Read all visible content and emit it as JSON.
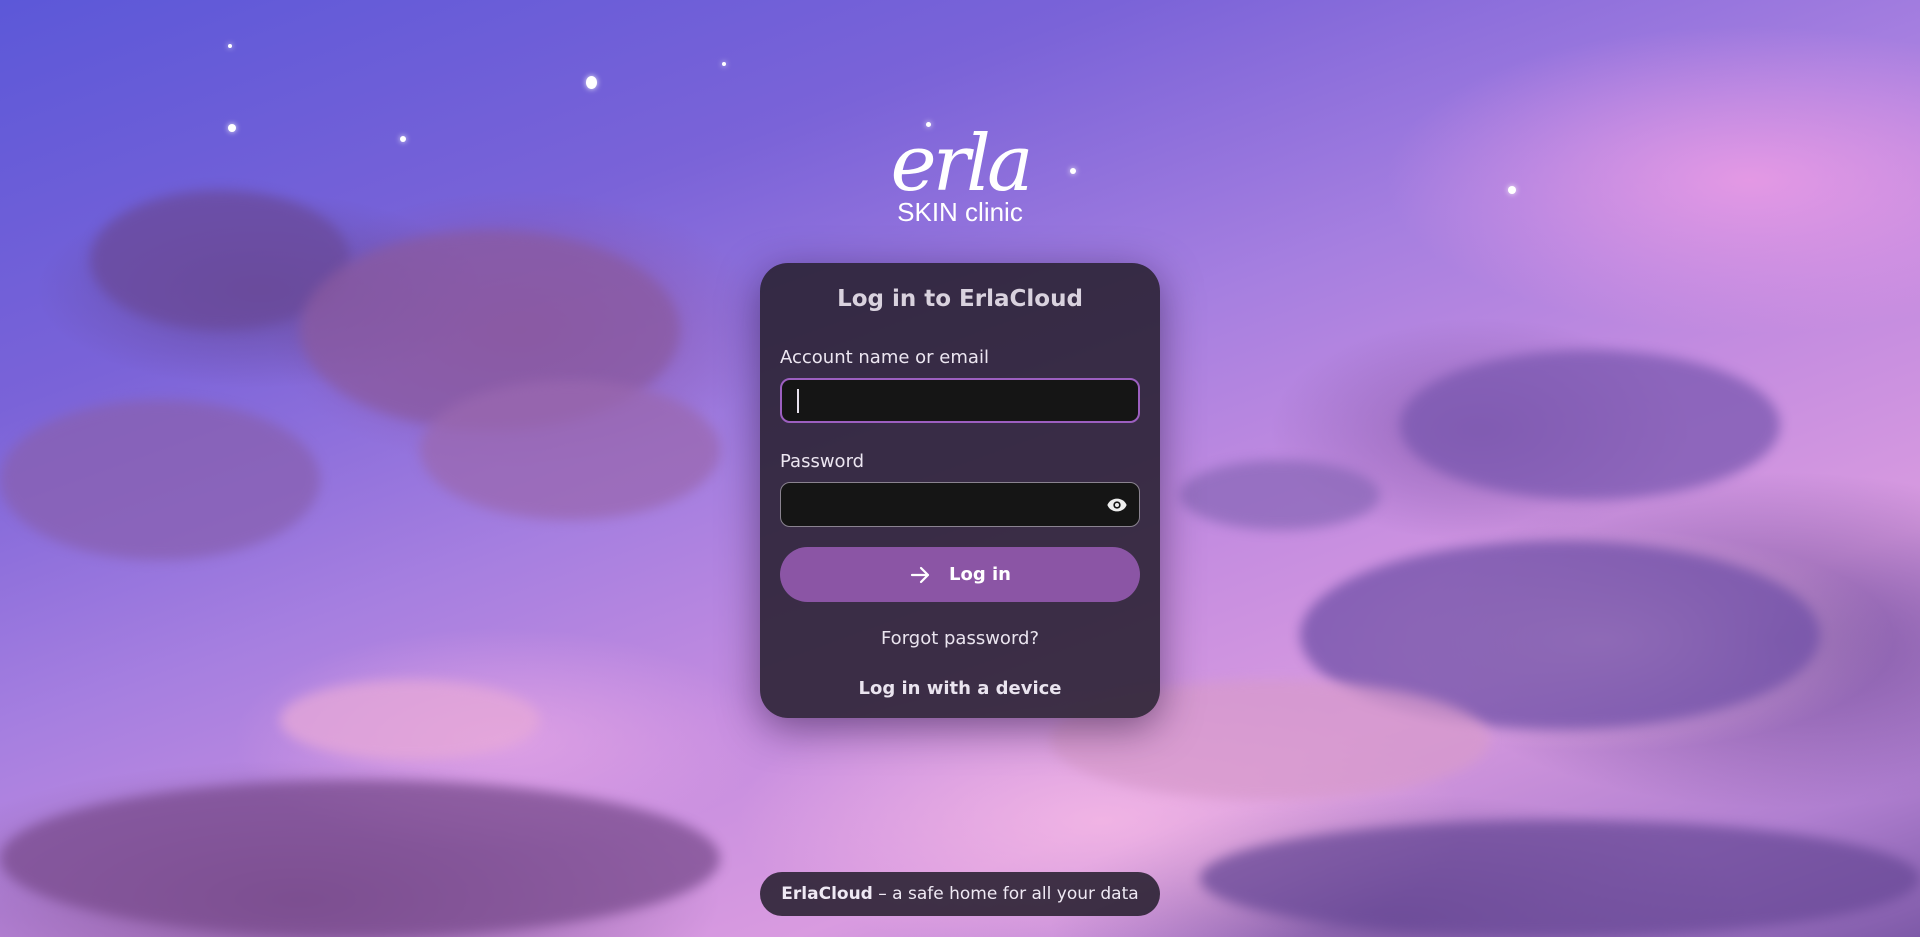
{
  "logo": {
    "mark": "erla",
    "subtitle": "SKIN clinic"
  },
  "login": {
    "title": "Log in to ErlaCloud",
    "account_label": "Account name or email",
    "account_value": "",
    "password_label": "Password",
    "password_value": "",
    "show_password_icon": "eye-icon",
    "submit_icon": "arrow-right-icon",
    "submit_label": "Log in",
    "forgot_link": "Forgot password?",
    "device_link": "Log in with a device"
  },
  "footer": {
    "brand": "ErlaCloud",
    "tagline": " – a safe home for all your data"
  },
  "colors": {
    "accent": "#8b55a5",
    "card_bg": "#282030",
    "input_bg": "#151515",
    "focus_border": "#9c5fc0"
  }
}
